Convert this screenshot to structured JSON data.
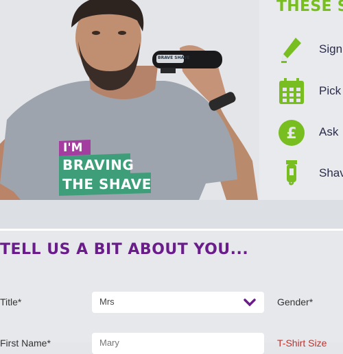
{
  "side": {
    "title": "THESE SI",
    "steps": [
      {
        "label": "Sign",
        "icon": "pencil-icon"
      },
      {
        "label": "Pick",
        "icon": "calendar-icon"
      },
      {
        "label": "Ask",
        "icon": "pound-coin-icon"
      },
      {
        "label": "Shav",
        "icon": "clippers-icon"
      }
    ]
  },
  "hero": {
    "tshirt_line1": "I'M",
    "tshirt_line2": "BRAVING",
    "tshirt_line3": "THE SHAVE",
    "clipper_brand": "BRAVE SHAVE"
  },
  "form": {
    "heading": "TELL US A BIT ABOUT YOU...",
    "title_label": "Title*",
    "title_value": "Mrs",
    "gender_label": "Gender*",
    "first_name_label": "First Name*",
    "first_name_value": "Mary",
    "tshirt_size_label": "T-Shirt Size"
  },
  "colors": {
    "green": "#78be20",
    "purple": "#6a1d8a"
  }
}
